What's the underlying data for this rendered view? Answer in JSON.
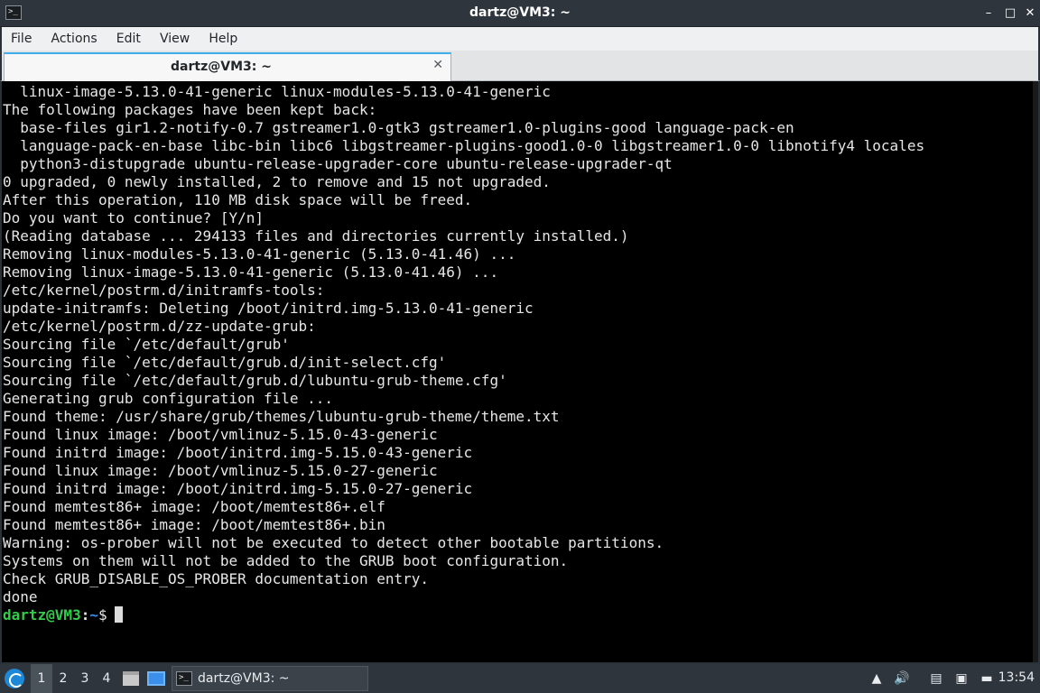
{
  "window": {
    "title": "dartz@VM3: ~",
    "app_icon_glyph": ">_",
    "controls": {
      "minimize": "–",
      "maximize": "□",
      "close": "✕"
    }
  },
  "menu": [
    "File",
    "Actions",
    "Edit",
    "View",
    "Help"
  ],
  "tab": {
    "label": "dartz@VM3: ~",
    "close": "✕"
  },
  "terminal": {
    "lines": [
      "  linux-image-5.13.0-41-generic linux-modules-5.13.0-41-generic",
      "The following packages have been kept back:",
      "  base-files gir1.2-notify-0.7 gstreamer1.0-gtk3 gstreamer1.0-plugins-good language-pack-en",
      "  language-pack-en-base libc-bin libc6 libgstreamer-plugins-good1.0-0 libgstreamer1.0-0 libnotify4 locales",
      "  python3-distupgrade ubuntu-release-upgrader-core ubuntu-release-upgrader-qt",
      "0 upgraded, 0 newly installed, 2 to remove and 15 not upgraded.",
      "After this operation, 110 MB disk space will be freed.",
      "Do you want to continue? [Y/n]",
      "(Reading database ... 294133 files and directories currently installed.)",
      "Removing linux-modules-5.13.0-41-generic (5.13.0-41.46) ...",
      "Removing linux-image-5.13.0-41-generic (5.13.0-41.46) ...",
      "/etc/kernel/postrm.d/initramfs-tools:",
      "update-initramfs: Deleting /boot/initrd.img-5.13.0-41-generic",
      "/etc/kernel/postrm.d/zz-update-grub:",
      "Sourcing file `/etc/default/grub'",
      "Sourcing file `/etc/default/grub.d/init-select.cfg'",
      "Sourcing file `/etc/default/grub.d/lubuntu-grub-theme.cfg'",
      "Generating grub configuration file ...",
      "Found theme: /usr/share/grub/themes/lubuntu-grub-theme/theme.txt",
      "Found linux image: /boot/vmlinuz-5.15.0-43-generic",
      "Found initrd image: /boot/initrd.img-5.15.0-43-generic",
      "Found linux image: /boot/vmlinuz-5.15.0-27-generic",
      "Found initrd image: /boot/initrd.img-5.15.0-27-generic",
      "Found memtest86+ image: /boot/memtest86+.elf",
      "Found memtest86+ image: /boot/memtest86+.bin",
      "Warning: os-prober will not be executed to detect other bootable partitions.",
      "Systems on them will not be added to the GRUB boot configuration.",
      "Check GRUB_DISABLE_OS_PROBER documentation entry.",
      "done"
    ],
    "prompt": {
      "user_host": "dartz@VM3",
      "sep": ":",
      "path": "~",
      "symbol": "$"
    }
  },
  "taskbar": {
    "desktops": [
      "1",
      "2",
      "3",
      "4"
    ],
    "active_desktop": "1",
    "task_label": "dartz@VM3: ~",
    "task_icon_glyph": ">_",
    "tray": {
      "updates_icon": "▲",
      "volume_icon": "🔊",
      "clipboard_icon": "▤",
      "network_icon": "▣",
      "battery_icon": "▬"
    },
    "clock": "13:54"
  }
}
